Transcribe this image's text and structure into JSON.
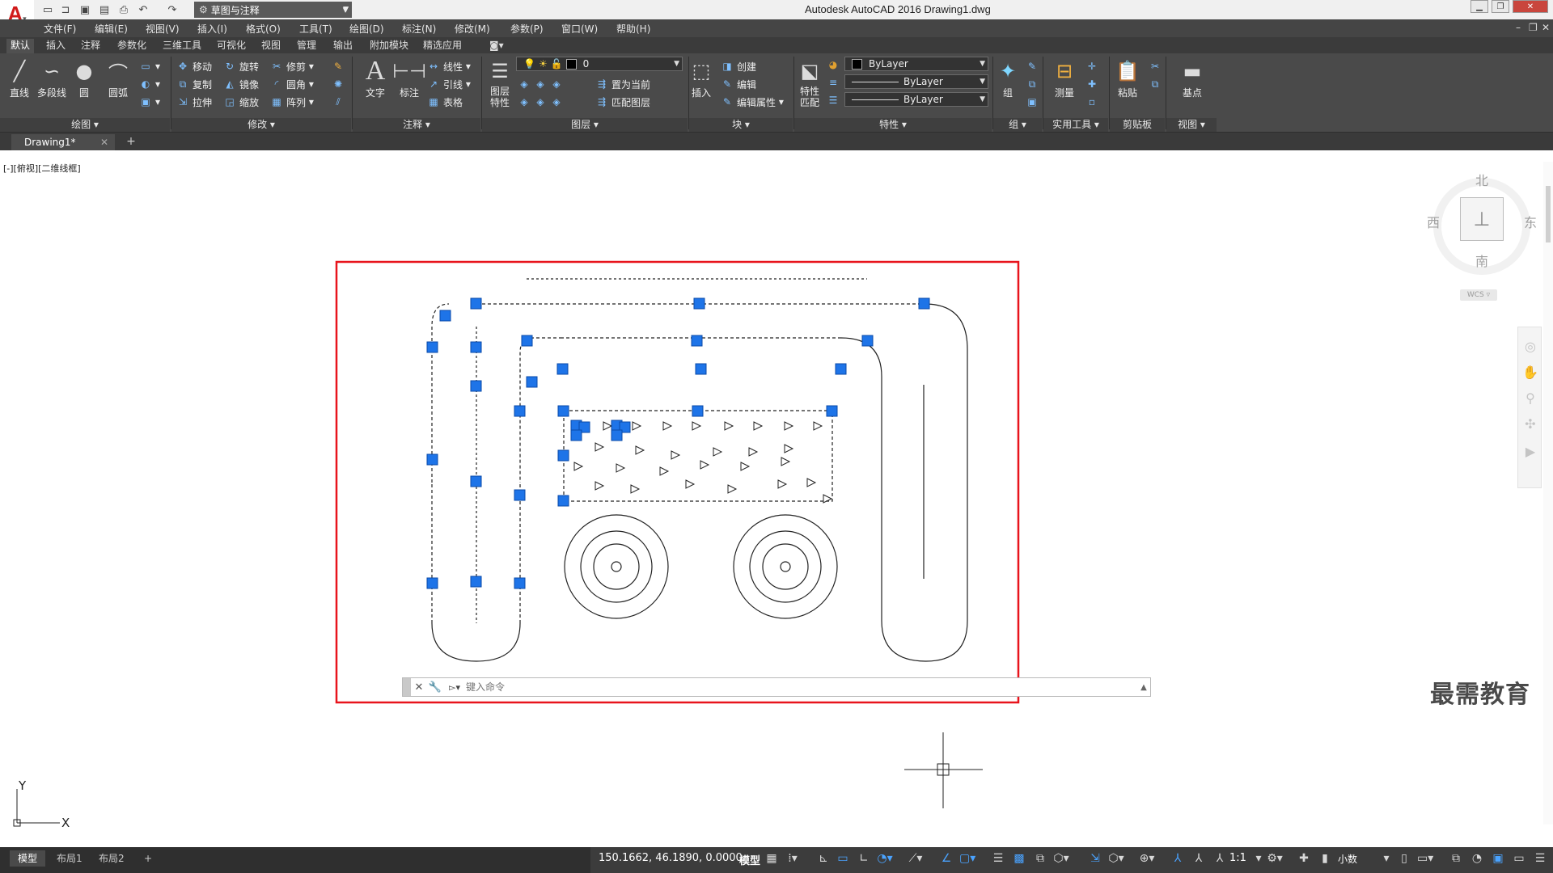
{
  "app": {
    "window_title": "Autodesk AutoCAD 2016    Drawing1.dwg",
    "workspace": "草图与注释"
  },
  "menu": [
    "文件(F)",
    "编辑(E)",
    "视图(V)",
    "插入(I)",
    "格式(O)",
    "工具(T)",
    "绘图(D)",
    "标注(N)",
    "修改(M)",
    "参数(P)",
    "窗口(W)",
    "帮助(H)"
  ],
  "ribbon_tabs": [
    "默认",
    "插入",
    "注释",
    "参数化",
    "三维工具",
    "可视化",
    "视图",
    "管理",
    "输出",
    "附加模块",
    "精选应用"
  ],
  "ribbon": {
    "draw": {
      "title": "绘图",
      "line": "直线",
      "polyline": "多段线",
      "circle": "圆",
      "arc": "圆弧"
    },
    "modify": {
      "title": "修改",
      "move": "移动",
      "rotate": "旋转",
      "trim": "修剪",
      "copy": "复制",
      "mirror": "镜像",
      "fillet": "圆角",
      "stretch": "拉伸",
      "scale": "缩放",
      "array": "阵列"
    },
    "annotation": {
      "title": "注释",
      "text": "文字",
      "dimension": "标注",
      "linear": "线性",
      "leader": "引线",
      "table": "表格"
    },
    "layers": {
      "title": "图层",
      "layer_props": "图层\n特性",
      "layer_name": "0",
      "set_current": "置为当前",
      "match_layer": "匹配图层"
    },
    "block": {
      "title": "块",
      "insert": "插入",
      "create": "创建",
      "edit": "编辑",
      "edit_attr": "编辑属性"
    },
    "properties": {
      "title": "特性",
      "match": "特性\n匹配",
      "color": "ByLayer",
      "linetype": "ByLayer",
      "lineweight": "ByLayer"
    },
    "groups": {
      "title": "组",
      "group": "组"
    },
    "utilities": {
      "title": "实用工具",
      "measure": "测量"
    },
    "clipboard": {
      "title": "剪贴板",
      "paste": "粘贴"
    },
    "view": {
      "title": "视图",
      "base": "基点"
    }
  },
  "file_tab": "Drawing1*",
  "viewport_label": "[-][俯视][二维线框]",
  "viewcube": {
    "north": "北",
    "south": "南",
    "east": "东",
    "west": "西",
    "wcs": "WCS"
  },
  "ucs": {
    "x": "X",
    "y": "Y"
  },
  "command": {
    "placeholder": "键入命令"
  },
  "layout_tabs": [
    "模型",
    "布局1",
    "布局2"
  ],
  "status": {
    "coords": "150.1662, 46.1890, 0.0000",
    "model": "模型",
    "scale": "1:1",
    "units": "小数"
  },
  "watermark": "最需教育",
  "colors": {
    "selection_rect": "#e8141c",
    "grip": "#1e74e8",
    "ribbon_bg": "#4a4a4a"
  }
}
